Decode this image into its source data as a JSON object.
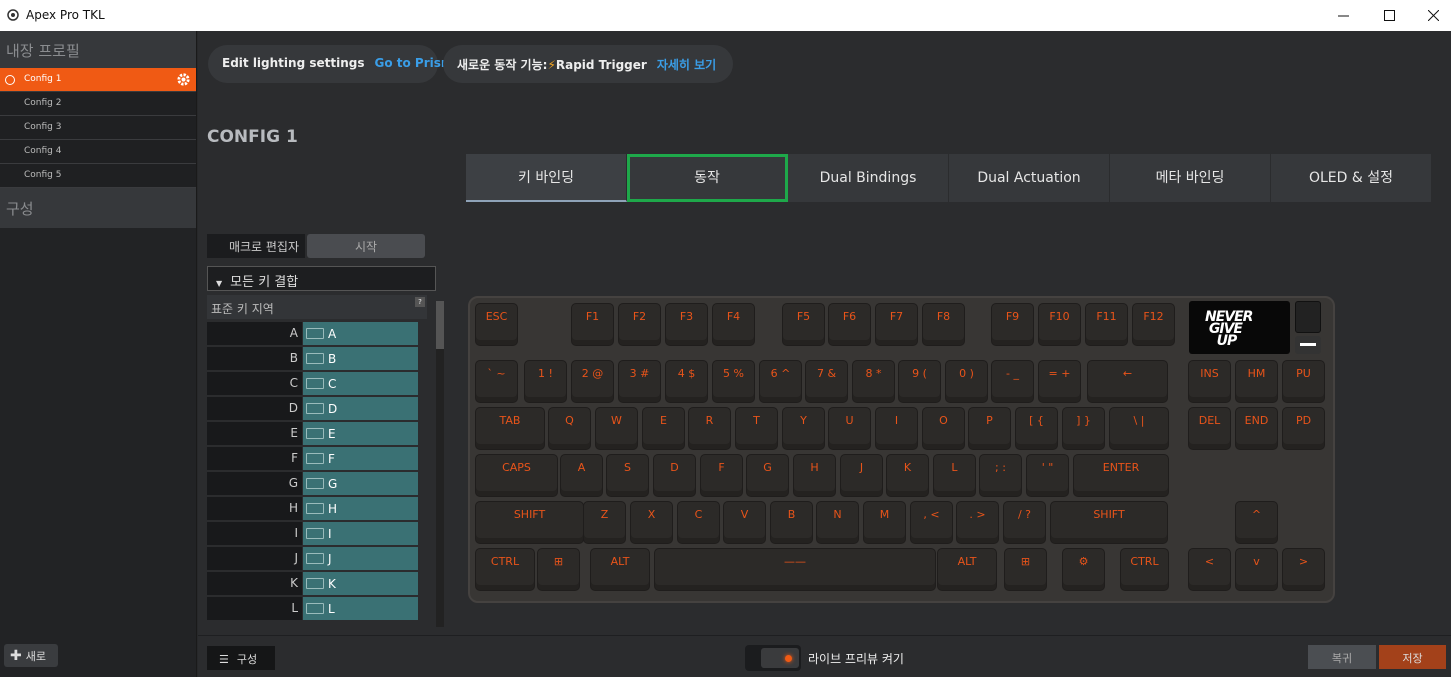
{
  "window": {
    "title": "Apex Pro TKL"
  },
  "sidebar": {
    "profiles_heading": "내장 프로필",
    "configs": [
      {
        "label": "Config 1",
        "active": true
      },
      {
        "label": "Config 2"
      },
      {
        "label": "Config 3"
      },
      {
        "label": "Config 4"
      },
      {
        "label": "Config 5"
      }
    ],
    "section_heading": "구성",
    "new_label": "새로"
  },
  "banners": {
    "lighting_text": "Edit lighting settings",
    "lighting_link": "Go to Prism",
    "feature_text": "새로운 동작 기능:",
    "feature_name": "Rapid Trigger",
    "feature_link": "자세히 보기"
  },
  "config_title": "CONFIG 1",
  "tabs": [
    {
      "label": "키 바인딩",
      "selected": true
    },
    {
      "label": "동작",
      "highlighted": true
    },
    {
      "label": "Dual Bindings"
    },
    {
      "label": "Dual Actuation"
    },
    {
      "label": "메타 바인딩"
    },
    {
      "label": "OLED & 설정"
    }
  ],
  "left_panel": {
    "macro_editor": "매크로 편집자",
    "start": "시작",
    "dropdown": "모든 키 결합",
    "standard_zone": "표준 키 지역",
    "help": "?",
    "rows": [
      {
        "key": "A",
        "value": "A"
      },
      {
        "key": "B",
        "value": "B"
      },
      {
        "key": "C",
        "value": "C"
      },
      {
        "key": "D",
        "value": "D"
      },
      {
        "key": "E",
        "value": "E"
      },
      {
        "key": "F",
        "value": "F"
      },
      {
        "key": "G",
        "value": "G"
      },
      {
        "key": "H",
        "value": "H"
      },
      {
        "key": "I",
        "value": "I"
      },
      {
        "key": "J",
        "value": "J"
      },
      {
        "key": "K",
        "value": "K"
      },
      {
        "key": "L",
        "value": "L"
      }
    ]
  },
  "keyboard": {
    "oled_text": "NEVER GIVE UP",
    "keys": [
      "ESC",
      "F1",
      "F2",
      "F3",
      "F4",
      "F5",
      "F6",
      "F7",
      "F8",
      "F9",
      "F10",
      "F11",
      "F12",
      "` ~",
      "1 !",
      "2 @",
      "3 #",
      "4 $",
      "5 %",
      "6 ^",
      "7 &",
      "8 *",
      "9 (",
      "0 )",
      "- _",
      "= +",
      "←",
      "INS",
      "HM",
      "PU",
      "TAB",
      "Q",
      "W",
      "E",
      "R",
      "T",
      "Y",
      "U",
      "I",
      "O",
      "P",
      "[ {",
      "] }",
      "\\ |",
      "DEL",
      "END",
      "PD",
      "CAPS",
      "A",
      "S",
      "D",
      "F",
      "G",
      "H",
      "J",
      "K",
      "L",
      "; :",
      "' \"",
      "ENTER",
      "SHIFT",
      "Z",
      "X",
      "C",
      "V",
      "B",
      "N",
      "M",
      ", <",
      ". >",
      "/ ?",
      "SHIFT",
      "^",
      "CTRL",
      "⊞",
      "ALT",
      "——",
      "ALT",
      "⊞",
      "⚙",
      "CTRL",
      "<",
      "v",
      ">"
    ]
  },
  "bottom": {
    "config_button": "구성",
    "live_preview": "라이브 프리뷰 켜기",
    "revert": "복귀",
    "save": "저장"
  },
  "colors": {
    "accent": "#f05a14",
    "tab_highlight": "#1ea84a",
    "link": "#3a9ee8",
    "binding": "#3a7174"
  }
}
